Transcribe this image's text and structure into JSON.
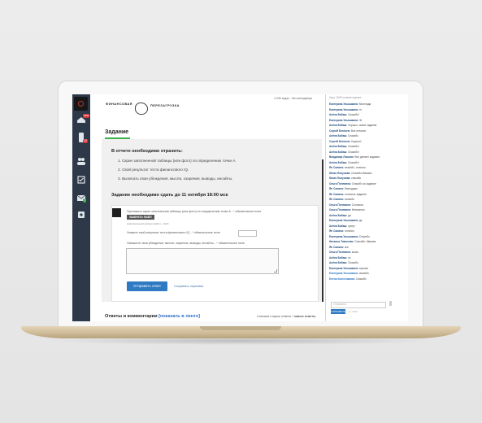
{
  "brand": {
    "line1": "ФИНАНСОВАЯ",
    "line2": "ПЕРЕЗАГРУЗКА"
  },
  "header": {
    "stat": "4 335 задач · без менеджера"
  },
  "task": {
    "title": "Задание",
    "heading": "В отчете необходимо отразить:",
    "items": [
      "1. Скрин заполненной таблицы (или фото) по определению точки А.",
      "2. Свой результат теста финансового IQ.",
      "3. Выписать свои убеждения, мысли, озарения, выводы, инсайты."
    ],
    "deadline": "Задание необходимо сдать до 11 октября 18:00 мск"
  },
  "form": {
    "attach_label": "Приложите скрин заполненной таблицы (или фото) по определению точки А - * обязательное поле",
    "file_button": "ВЫБРАТЬ ФАЙЛ",
    "file_hint": "максимальный размер файла - 10мб",
    "iq_label": "Укажите свой результат теста финансового IQ - * обязательное поле",
    "beliefs_label": "Напишите свои убеждения, мысли, озарения, выводы, инсайты... * обязательное поле",
    "submit": "Отправить ответ",
    "save_draft": "Сохранить черновик"
  },
  "answers": {
    "title": "Ответы и комментарии",
    "link": "[показать в ленте]",
    "sort_old": "Сначала старые ответы",
    "sort_sep": "/",
    "sort_new": "новые ответы"
  },
  "sidebar": {
    "badges": [
      "new",
      "12",
      "7",
      "23"
    ]
  },
  "chat": {
    "search": "Ищи 1835 комментариев",
    "messages": [
      {
        "name": "Екатерина Ульяшкина:",
        "text": "Кеоплада"
      },
      {
        "name": "Екатерина Ульяшкина:",
        "text": "гп"
      },
      {
        "name": "Алёна Бабаш:",
        "text": "Спасибо!"
      },
      {
        "name": "Екатерина Ульяшкина:",
        "text": "Эт"
      },
      {
        "name": "Алёна Бабаш:",
        "text": "Хорошо. новое задание"
      },
      {
        "name": "Сергей Бегичев:",
        "text": "Все отлично"
      },
      {
        "name": "Алёна Бабаш:",
        "text": "Спасибо"
      },
      {
        "name": "Сергей Бегичев:",
        "text": "Хорошо!"
      },
      {
        "name": "Алёна Бабаш:",
        "text": "Спасибо!"
      },
      {
        "name": "Алёна Бабаш:",
        "text": "Спасибо!"
      },
      {
        "name": "Владимир Лошкин:",
        "text": "Все делают задания"
      },
      {
        "name": "Алёна Бабаш:",
        "text": "Спасибо!"
      },
      {
        "name": "Ян Салина:",
        "text": "спасибо, отлично"
      },
      {
        "name": "Юлия Лопухова:",
        "text": "Спасибо Максим"
      },
      {
        "name": "Юлия Лопухова:",
        "text": "спасибо"
      },
      {
        "name": "Ольга Пелевина:",
        "text": "Спасибо за задание"
      },
      {
        "name": "Ян Салина:",
        "text": "благодарю"
      },
      {
        "name": "Ян Салина:",
        "text": "отличное задание"
      },
      {
        "name": "Ян Салина:",
        "text": "спасибо"
      },
      {
        "name": "Ольга Пелевина:",
        "text": "Согласна"
      },
      {
        "name": "Ольга Пелевина:",
        "text": "Интересно"
      },
      {
        "name": "Алёна Бабаш:",
        "text": "да"
      },
      {
        "name": "Екатерина Ульяшкина:",
        "text": "да"
      },
      {
        "name": "Алёна Бабаш:",
        "text": "супер"
      },
      {
        "name": "Ян Салина:",
        "text": "отлично"
      },
      {
        "name": "Екатерина Ульяшкина:",
        "text": "Спасибо"
      },
      {
        "name": "Наталья Тимченко:",
        "text": "Спасибо, Максим"
      },
      {
        "name": "Ян Салина:",
        "text": "ага"
      },
      {
        "name": "Ольга Пелевина:",
        "text": "класс"
      },
      {
        "name": "Алёна Бабаш:",
        "text": "ок"
      },
      {
        "name": "Алёна Бабаш:",
        "text": "Спасибо"
      },
      {
        "name": "Екатерина Ульяшкина:",
        "text": "хорошо"
      },
      {
        "name": "Екатерина Ульяшкина:",
        "text": "спасибо"
      },
      {
        "name": "Елена Колесникова:",
        "text": "Спасибо"
      }
    ],
    "input_placeholder": "Отправить",
    "send": "ОТПРАВИТЬ",
    "chars": "0 / 1000"
  }
}
